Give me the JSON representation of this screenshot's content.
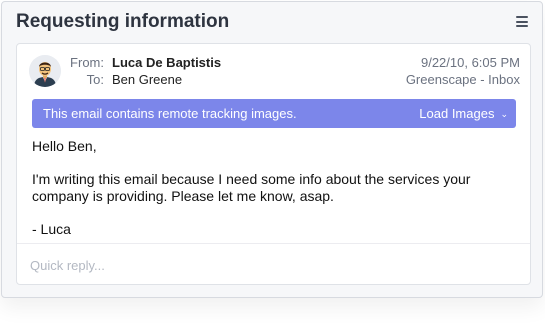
{
  "window": {
    "title": "Requesting information"
  },
  "menu_icon": "hamburger-menu-icon",
  "email": {
    "from_label": "From:",
    "from_name": "Luca De Baptistis",
    "to_label": "To:",
    "to_name": "Ben Greene",
    "date": "9/22/10, 6:05 PM",
    "folder": "Greenscape - Inbox",
    "avatar_icon": "user-avatar-icon"
  },
  "banner": {
    "text": "This email contains remote tracking images.",
    "button_label": "Load Images",
    "chevron": "⌄",
    "color": "#7c86ea"
  },
  "body": {
    "greeting": "Hello Ben,",
    "paragraph": "I'm writing this email because I need some info about the services your company is providing. Please let me know, asap.",
    "signoff": "- Luca"
  },
  "reply": {
    "placeholder": "Quick reply..."
  }
}
